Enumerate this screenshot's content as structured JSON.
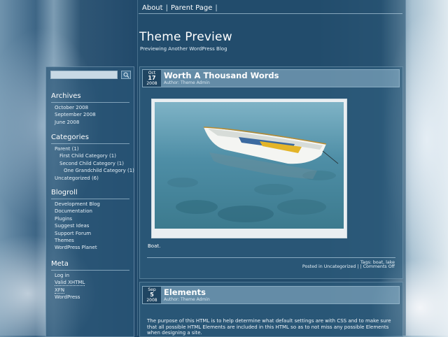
{
  "nav": {
    "items": [
      "About",
      "Parent Page"
    ]
  },
  "site": {
    "title": "Theme Preview",
    "description": "Previewing Another WordPress Blog"
  },
  "sidebar": {
    "search": {
      "placeholder": "",
      "icon": "search-icon"
    },
    "archives": {
      "title": "Archives",
      "items": [
        "October 2008",
        "September 2008",
        "June 2008"
      ]
    },
    "categories": {
      "title": "Categories",
      "items": [
        "Parent (1)",
        "First Child Category (1)",
        "Second Child Category (1)",
        "One Grandchild Category (1)",
        "Uncategorized (6)"
      ]
    },
    "blogroll": {
      "title": "Blogroll",
      "items": [
        "Development Blog",
        "Documentation",
        "Plugins",
        "Suggest Ideas",
        "Support Forum",
        "Themes",
        "WordPress Planet"
      ]
    },
    "meta": {
      "title": "Meta",
      "items": [
        "Log in",
        "Valid XHTML",
        "XFN",
        "WordPress"
      ]
    }
  },
  "posts": [
    {
      "date": {
        "month": "Oct",
        "day": "17",
        "year": "2008"
      },
      "title": "Worth A Thousand Words",
      "author": "Author: Theme Admin",
      "caption": "Boat.",
      "tags": "Tags: boat, lake",
      "posted": "Posted in Uncategorized |  | Comments Off"
    },
    {
      "date": {
        "month": "Sep",
        "day": "5",
        "year": "2008"
      },
      "title": "Elements",
      "author": "Author: Theme Admin",
      "excerpt": "The purpose of this HTML is to help determine what default settings are with CSS and to make sure that all possible HTML Elements are included in this HTML so as to not miss any possible Elements when designing a site."
    }
  ],
  "colors": {
    "accent": "#1f4562",
    "header_bar": "#96b9d0"
  }
}
